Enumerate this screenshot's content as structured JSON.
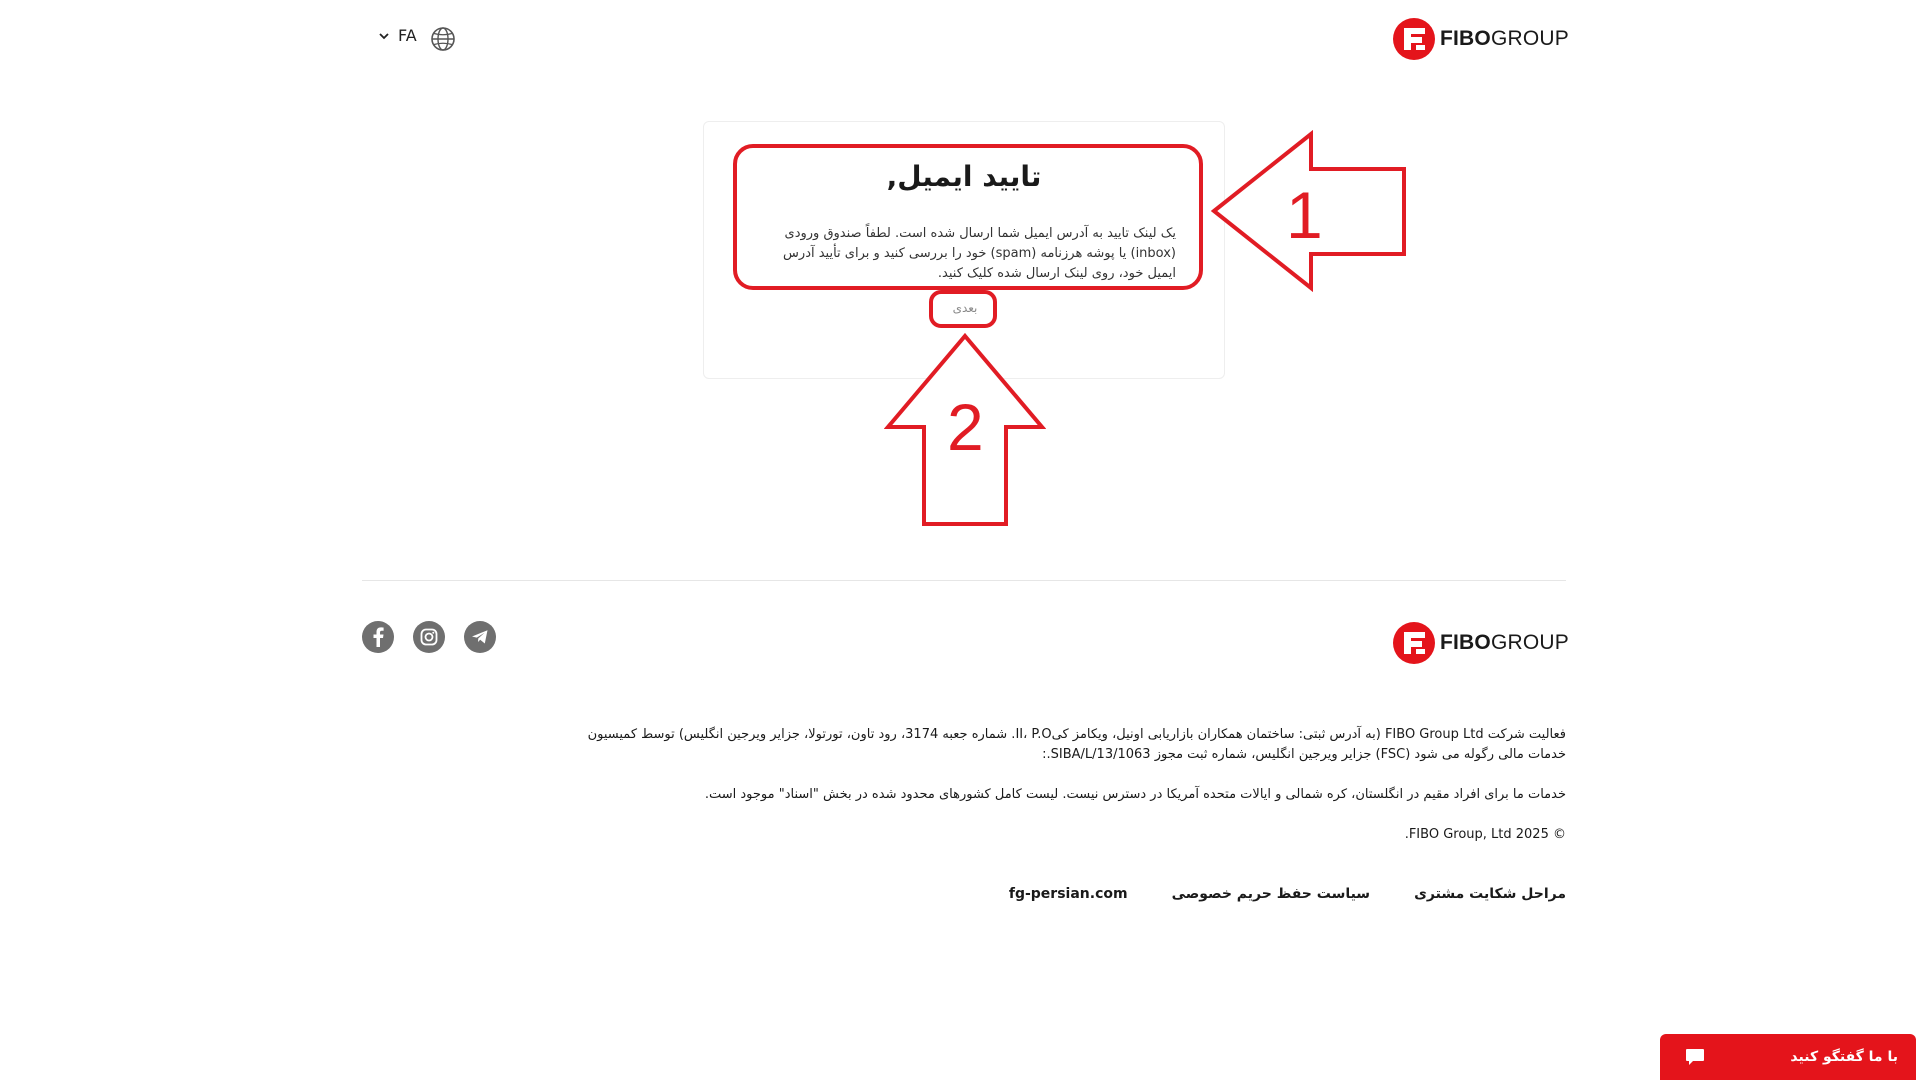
{
  "brand": {
    "wordmark_bold": "FIBO",
    "wordmark_light": "GROUP",
    "red": "#e4141b"
  },
  "header": {
    "language_code": "FA",
    "globe_icon": "globe-icon",
    "chevron_icon": "chevron-down-icon"
  },
  "card": {
    "title": "تایید ایمیل,",
    "message": "یک لینک تایید به آدرس ایمیل شما ارسال شده است. لطفاً صندوق ورودی (inbox) یا پوشه هرزنامه (spam) خود را بررسی کنید و برای تأیید آدرس ایمیل خود، روی لینک ارسال شده کلیک کنید.",
    "next_label": "بعدی"
  },
  "annotations": {
    "color": "#e11c24",
    "arrow_1_label": "1",
    "arrow_2_label": "2"
  },
  "footer": {
    "legal_line_1": "فعالیت شرکت FIBO Group Ltd (به آدرس ثبتی: ساختمان همکاران بازاریابی اونیل، ویکامز کیII، P.O. شماره جعبه 3174، رود تاون، تورتولا، جزایر ویرجین انگلیس) توسط کمیسیون خدمات مالی رگوله می شود (FSC) جزایر ویرجین انگلیس، شماره ثبت مجوز SIBA/L/13/1063.:",
    "legal_line_2": "خدمات ما برای افراد مقیم در انگلستان، کره شمالی و ایالات متحده آمریکا در دسترس نیست. لیست کامل کشورهای محدود شده در بخش \"اسناد\" موجود است.",
    "copyright": "© FIBO Group, Ltd 2025.",
    "links": [
      "مراحل شکایت مشتری",
      "سیاست حفظ حریم خصوصی",
      "fg-persian.com"
    ],
    "social_icons": [
      "facebook-icon",
      "instagram-icon",
      "telegram-icon"
    ]
  },
  "chat": {
    "label": "با ما گفتگو کنید",
    "icon": "chat-bubble-icon"
  }
}
